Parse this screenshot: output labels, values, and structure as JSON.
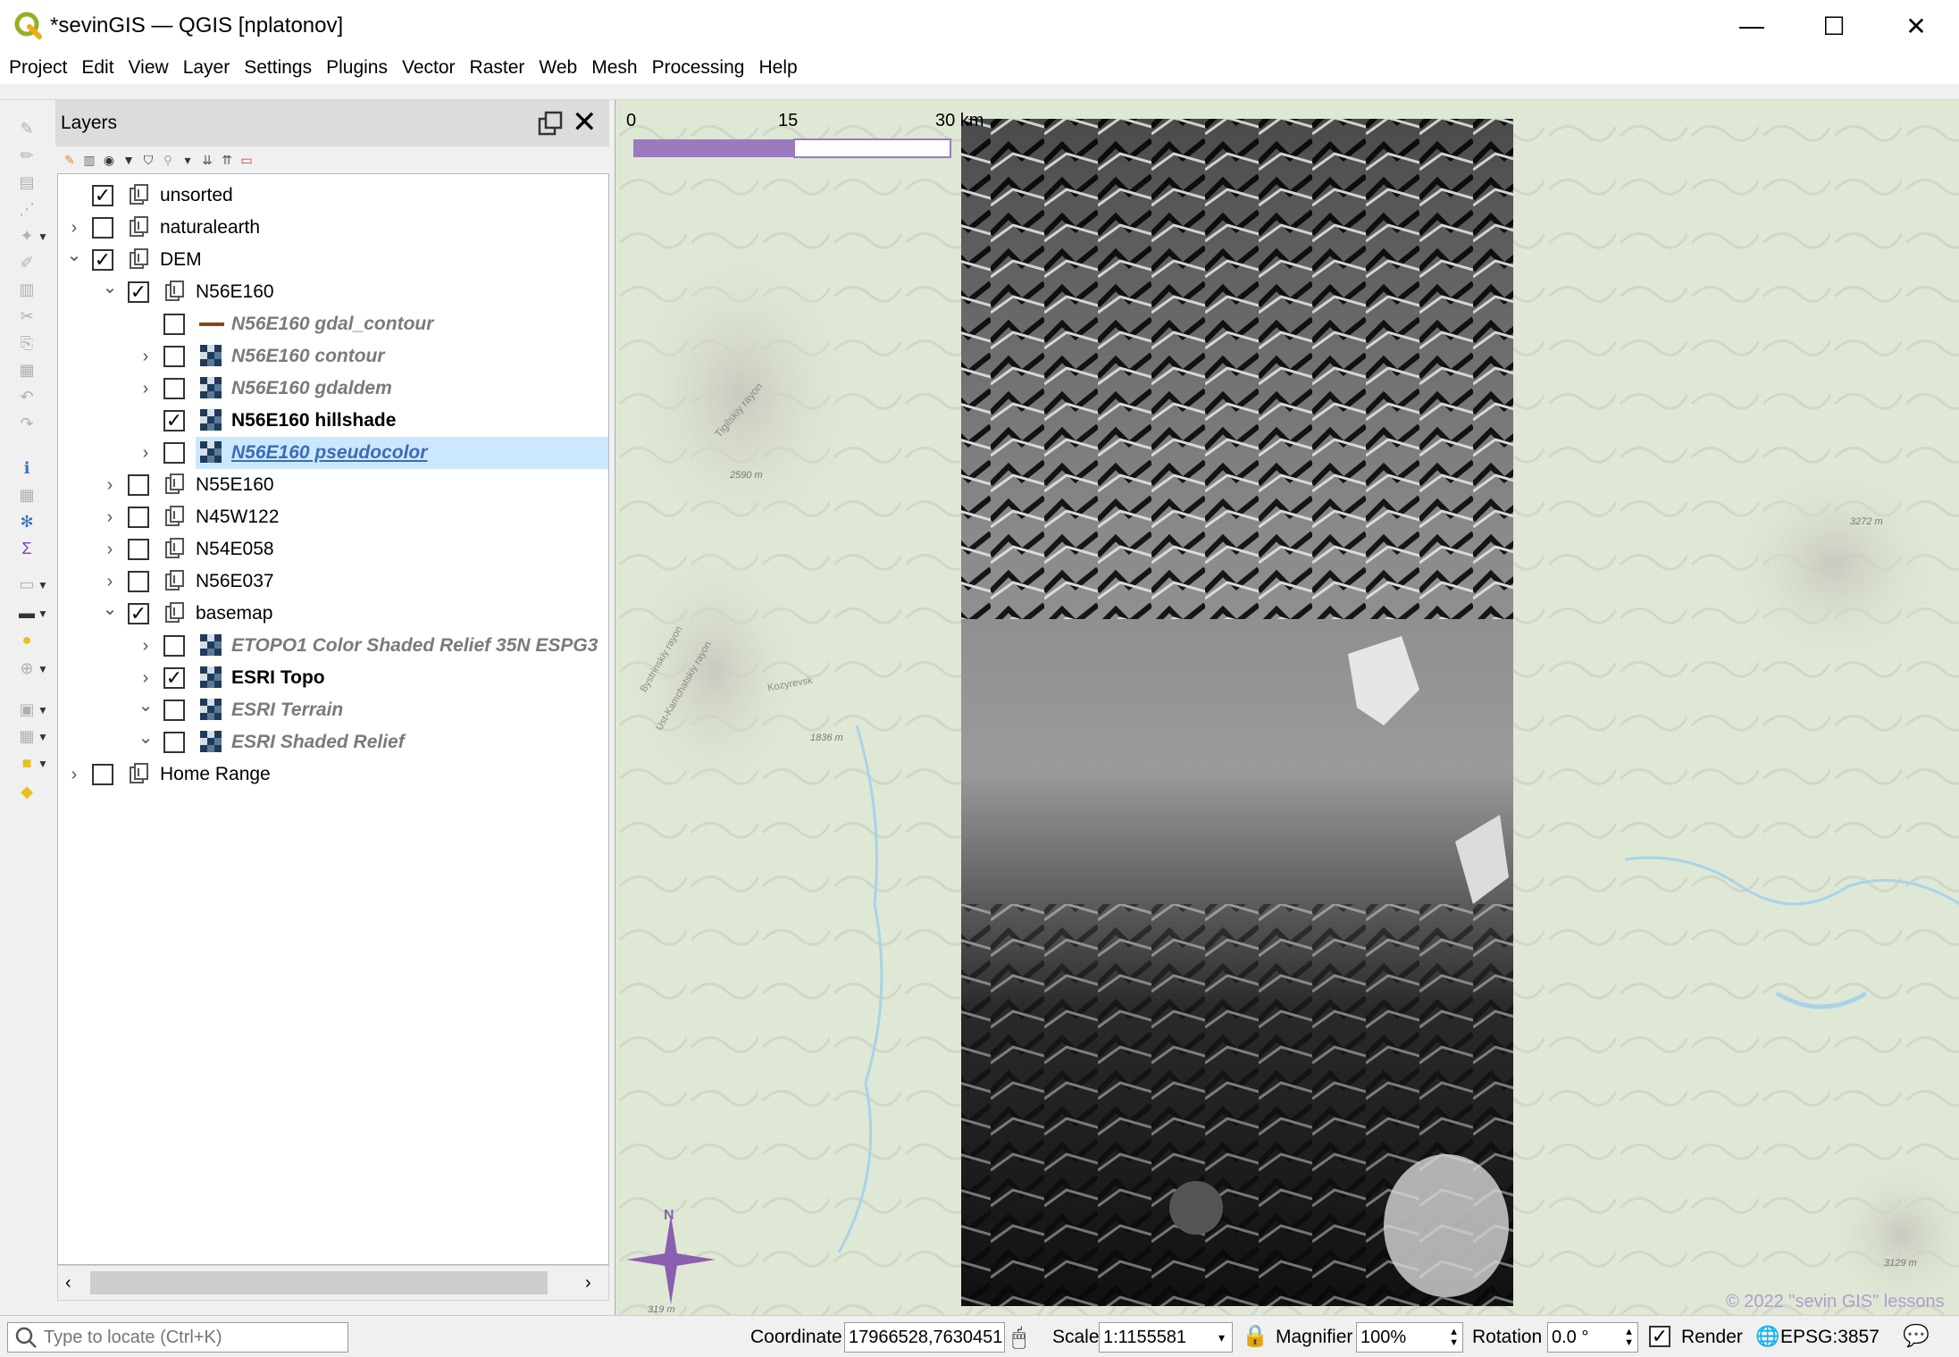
{
  "window": {
    "title": "*sevinGIS — QGIS [nplatonov]",
    "minimize": "—",
    "maximize": "☐",
    "close": "✕"
  },
  "menu": [
    "Project",
    "Edit",
    "View",
    "Layer",
    "Settings",
    "Plugins",
    "Vector",
    "Raster",
    "Web",
    "Mesh",
    "Processing",
    "Help"
  ],
  "layers_panel": {
    "title": "Layers",
    "close_glyph": "✕"
  },
  "layers": [
    {
      "name": "unsorted",
      "checked": true,
      "expander": "none",
      "type": "group",
      "style": "normal"
    },
    {
      "name": "naturalearth",
      "checked": false,
      "expander": "collapsed",
      "type": "group",
      "style": "normal"
    },
    {
      "name": "DEM",
      "checked": true,
      "expander": "expanded",
      "type": "group",
      "style": "normal"
    },
    {
      "name": "N56E160",
      "checked": true,
      "expander": "expanded",
      "type": "group",
      "style": "normal"
    },
    {
      "name": "N56E160 gdal_contour",
      "checked": false,
      "expander": "none",
      "type": "line",
      "style": "dim"
    },
    {
      "name": "N56E160 contour",
      "checked": false,
      "expander": "collapsed",
      "type": "raster",
      "style": "dim"
    },
    {
      "name": "N56E160 gdaldem",
      "checked": false,
      "expander": "collapsed",
      "type": "raster",
      "style": "dim"
    },
    {
      "name": "N56E160 hillshade",
      "checked": true,
      "expander": "none",
      "type": "raster",
      "style": "bold"
    },
    {
      "name": "N56E160 pseudocolor",
      "checked": false,
      "expander": "collapsed",
      "type": "raster",
      "style": "link",
      "selected": true
    },
    {
      "name": "N55E160",
      "checked": false,
      "expander": "collapsed",
      "type": "group",
      "style": "normal"
    },
    {
      "name": "N45W122",
      "checked": false,
      "expander": "collapsed",
      "type": "group",
      "style": "normal"
    },
    {
      "name": "N54E058",
      "checked": false,
      "expander": "collapsed",
      "type": "group",
      "style": "normal"
    },
    {
      "name": "N56E037",
      "checked": false,
      "expander": "collapsed",
      "type": "group",
      "style": "normal"
    },
    {
      "name": "basemap",
      "checked": true,
      "expander": "expanded",
      "type": "group",
      "style": "normal"
    },
    {
      "name": "ETOPO1 Color Shaded Relief 35N ESPG3",
      "checked": false,
      "expander": "collapsed",
      "type": "raster",
      "style": "dim"
    },
    {
      "name": "ESRI Topo",
      "checked": true,
      "expander": "collapsed",
      "type": "raster",
      "style": "bold"
    },
    {
      "name": "ESRI Terrain",
      "checked": false,
      "expander": "expanded",
      "type": "raster",
      "style": "dim"
    },
    {
      "name": "ESRI Shaded Relief",
      "checked": false,
      "expander": "expanded",
      "type": "raster",
      "style": "dim"
    },
    {
      "name": "Home Range",
      "checked": false,
      "expander": "collapsed",
      "type": "group",
      "style": "normal"
    }
  ],
  "map": {
    "scalebar": {
      "labels": [
        "0",
        "15",
        "30 km"
      ],
      "color": "#9b7bbf"
    },
    "north_label": "N",
    "labels": [
      "Tigilskiy rayon",
      "2590 m",
      "Bystrinskiy rayon",
      "Ust-Kamchatskiy rayon",
      "Kozyrevsk",
      "1836 m",
      "3272 m",
      "3129 m",
      "319 m"
    ],
    "attribution": "© 2022 \"sevin GIS\" lessons",
    "colors": {
      "land": "#dfe8d4",
      "water": "#a9d3e8",
      "dem": "#1a1a1a"
    }
  },
  "status": {
    "locate_placeholder": "Type to locate (Ctrl+K)",
    "coordinate_label": "Coordinate",
    "coordinate_value": "17966528,7630451",
    "scale_label": "Scale",
    "scale_value": "1:1155581",
    "magnifier_label": "Magnifier",
    "magnifier_value": "100%",
    "rotation_label": "Rotation",
    "rotation_value": "0.0 °",
    "render_label": "Render",
    "crs": "EPSG:3857"
  }
}
